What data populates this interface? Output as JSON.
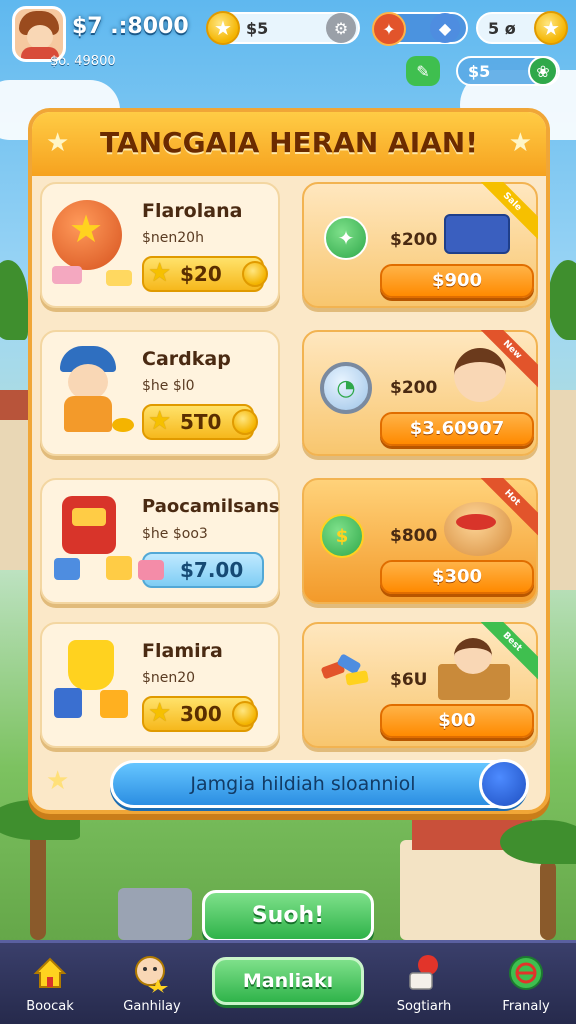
{
  "hud": {
    "money": "$7 .:8000",
    "sub_money": "$o. 49800",
    "stars_value": "$5",
    "gem_value": "5 ø",
    "badge_value": "$5",
    "colors": {
      "gold": "#f4b400",
      "panel_border": "#f0a637",
      "accent_blue": "#2b8ee2",
      "accent_green": "#2fb34a"
    }
  },
  "panel": {
    "title": "TANCGAIA HERAN AIAN!"
  },
  "items_left": [
    {
      "name": "Flarolana",
      "sub": "$nen20h",
      "price": "$20",
      "price_style": "gold",
      "icon": "star-chest-icon"
    },
    {
      "name": "Cardkap",
      "sub": "$he $l0",
      "price": "5T0",
      "price_style": "gold",
      "icon": "worker-character-icon"
    },
    {
      "name": "Paocamilsans",
      "sub": "$he $oo3",
      "price": "$7.00",
      "price_style": "blue",
      "icon": "robot-toy-icon"
    },
    {
      "name": "Flamira",
      "sub": "$nen20",
      "price": "300",
      "price_style": "gold",
      "icon": "trophy-blocks-icon"
    }
  ],
  "items_right": [
    {
      "price": "$200",
      "button": "$900",
      "ribbon": "Sale",
      "icon": "toolbox-icon"
    },
    {
      "price": "$200",
      "button": "$3.60907",
      "ribbon": "New",
      "icon": "stopwatch-icon"
    },
    {
      "price": "$800",
      "button": "$300",
      "ribbon": "Hot",
      "icon": "bun-icon"
    },
    {
      "price": "$6U",
      "button": "$00",
      "ribbon": "Best",
      "icon": "arrows-box-icon"
    }
  ],
  "info_bar": {
    "text": "Jamgia hildiah sloanniol"
  },
  "main_button": {
    "label": "Suoh!"
  },
  "bottom_nav": {
    "items": [
      {
        "label": "Boocak",
        "icon": "home-icon"
      },
      {
        "label": "Ganhilay",
        "icon": "character-star-icon"
      },
      {
        "label": "Sogtiarh",
        "icon": "gift-balloon-icon"
      },
      {
        "label": "Franaly",
        "icon": "globe-icon"
      }
    ],
    "center_label": "Manliakı"
  }
}
